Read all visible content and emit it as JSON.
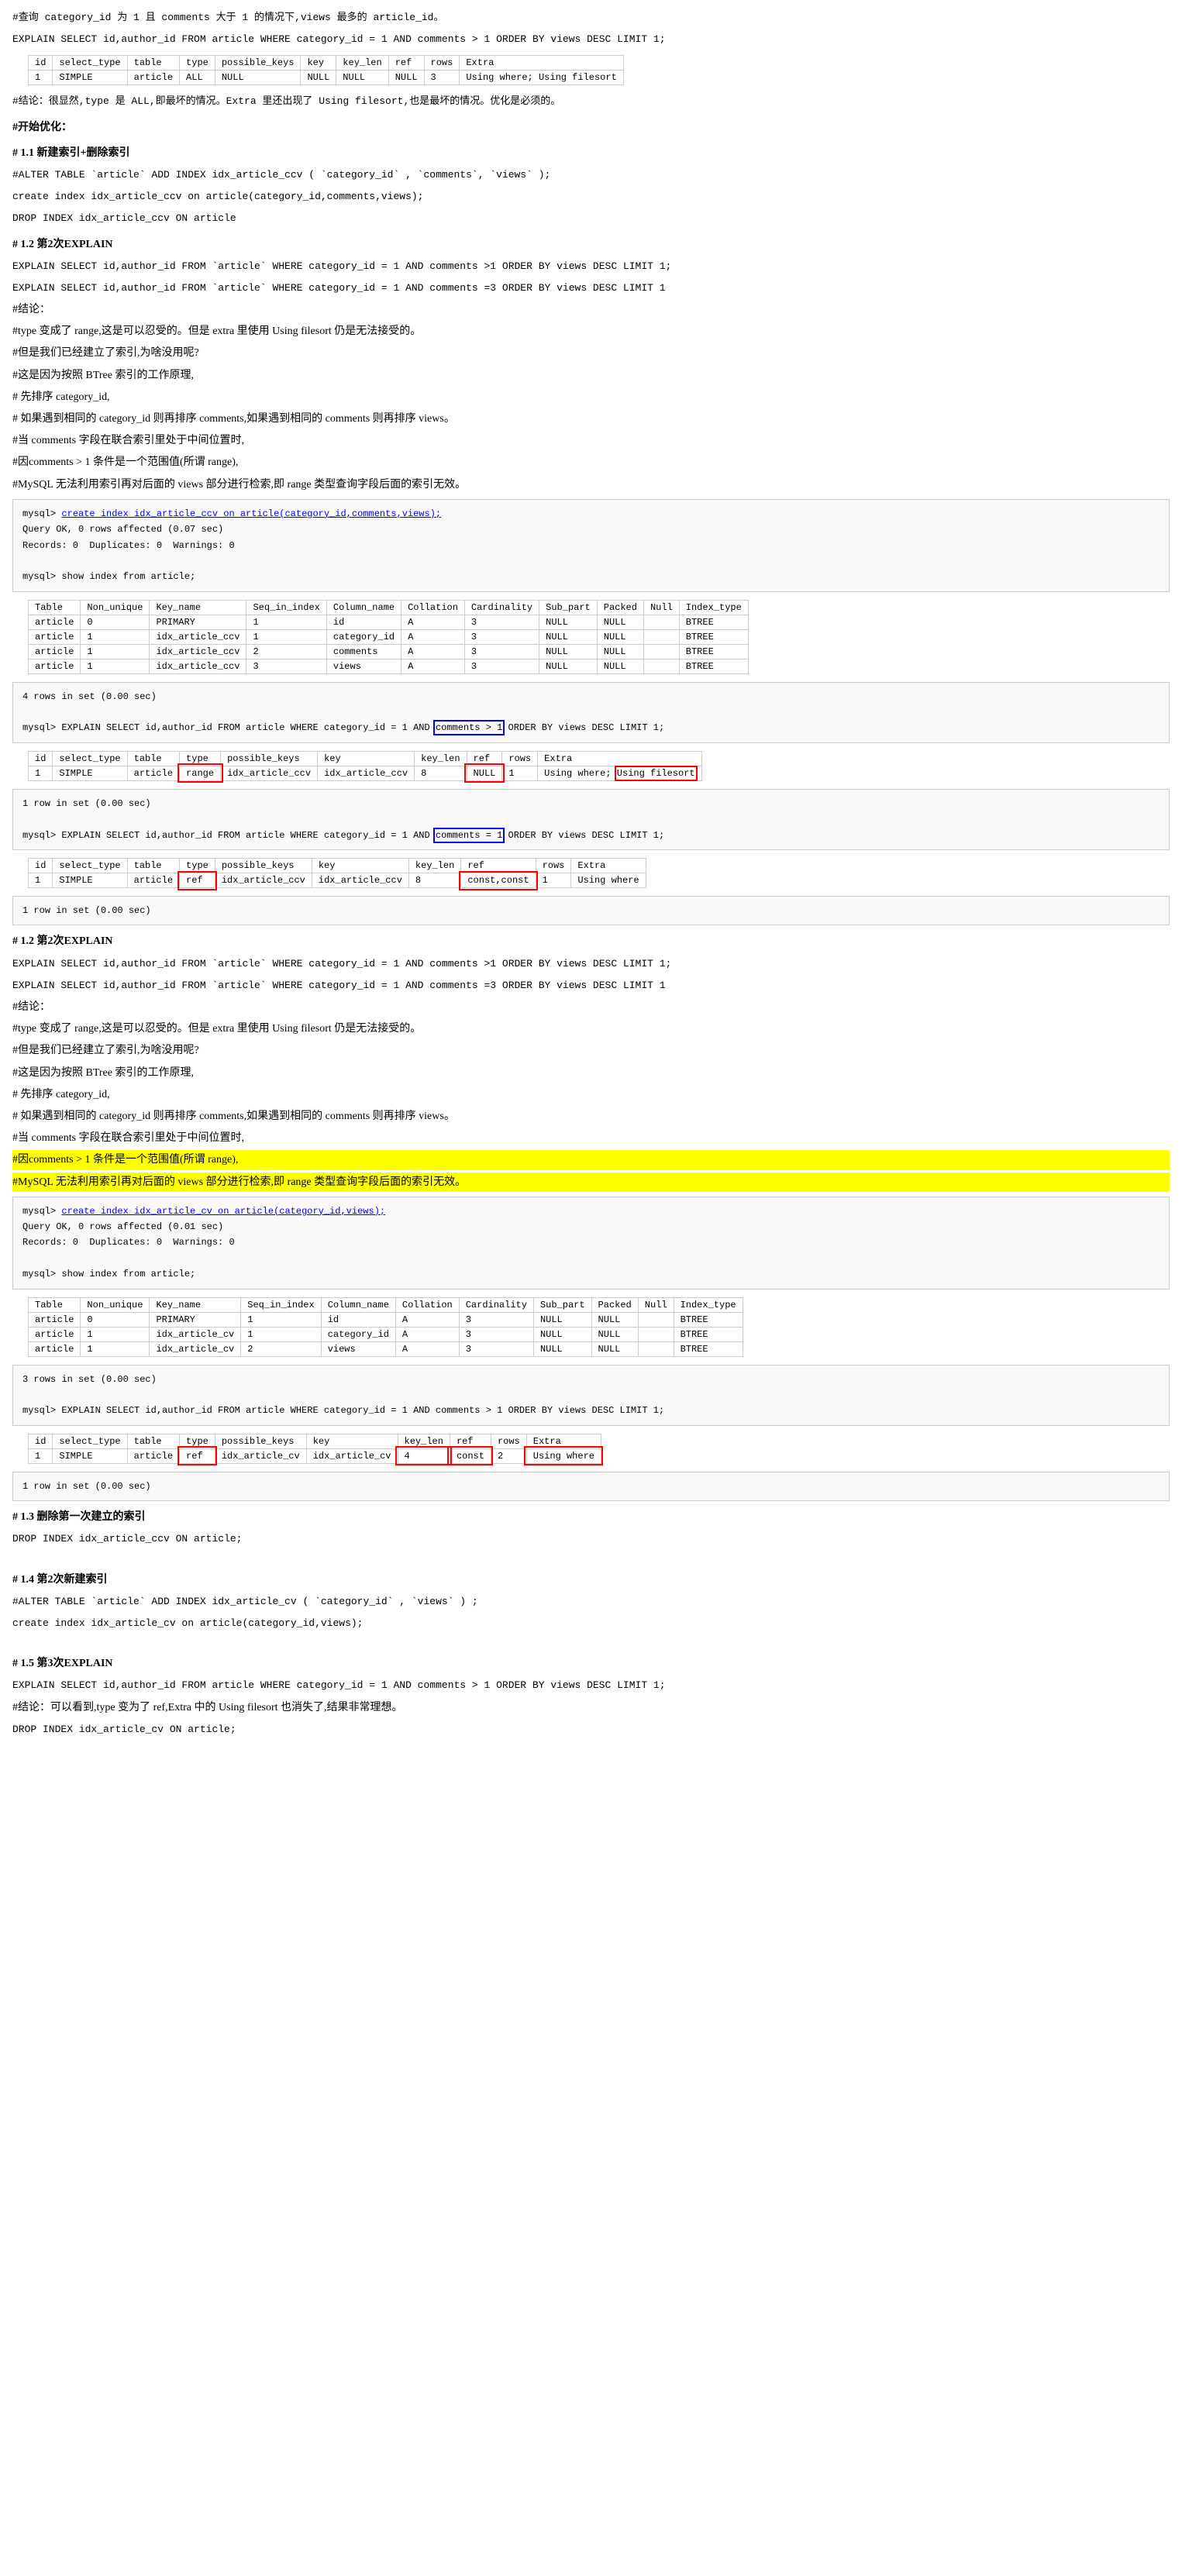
{
  "content": {
    "intro_comment": "#查询 category_id 为 1 且 comments 大于 1 的情况下,views 最多的 article_id。",
    "explain_sql": "EXPLAIN SELECT id,author_id FROM article WHERE category_id = 1 AND comments > 1 ORDER BY views DESC LIMIT 1;",
    "conclusion1_title": "#结论：很显然,type 是 ALL,即最坏的情况。Extra 里还出现了 Using filesort,也是最坏的情况。优化是必须的。",
    "optimize_title": "#开始优化：",
    "sec11_title": "# 1.1 新建索引+删除索引",
    "alter_comment": "#ALTER TABLE `article` ADD INDEX idx_article_ccv ( `category_id` , `comments`, `views` );",
    "create_index": "create index idx_article_ccv on article(category_id,comments,views);",
    "drop_index": "DROP INDEX idx_article_ccv ON article",
    "sec12_title": "# 1.2 第2次EXPLAIN",
    "explain2_1": "EXPLAIN SELECT id,author_id FROM `article` WHERE category_id = 1 AND comments >1 ORDER BY views DESC LIMIT 1;",
    "explain2_2": "EXPLAIN SELECT id,author_id FROM `article` WHERE category_id = 1 AND comments =3 ORDER BY views DESC LIMIT 1",
    "jielun_label": "#结论：",
    "jielun_lines": [
      "#type 变成了 range,这是可以忍受的。但是 extra 里使用 Using filesort 仍是无法接受的。",
      "#但是我们已经建立了索引,为啥没用呢?",
      "#这是因为按照 BTree 索引的工作原理,",
      "# 先排序 category_id,",
      "# 如果遇到相同的 category_id 则再排序 comments,如果遇到相同的 comments 则再排序 views。",
      "#当 comments 字段在联合索引里处于中间位置时,",
      "#因comments > 1 条件是一个范围值(所谓 range),",
      "#MySQL 无法利用索引再对后面的 views 部分进行检索,即 range 类型查询字段后面的索引无效。"
    ],
    "sec12b_title": "# 1.2 第2次EXPLAIN",
    "explain2b_1": "EXPLAIN SELECT id,author_id FROM `article` WHERE category_id = 1 AND comments >1 ORDER BY views DESC LIMIT 1;",
    "explain2b_2": "EXPLAIN SELECT id,author_id FROM `article` WHERE category_id = 1 AND comments =3 ORDER BY views DESC LIMIT 1",
    "jielun2_label": "#结论：",
    "jielun2_lines": [
      "#type 变成了 range,这是可以忍受的。但是 extra 里使用 Using filesort 仍是无法接受的。",
      "#但是我们已经建立了索引,为啥没用呢?",
      "#这是因为按照 BTree 索引的工作原理,",
      "# 先排序 category_id,",
      "# 如果遇到相同的 category_id 则再排序 comments,如果遇到相同的 comments 则再排序 views。",
      "#当 comments 字段在联合索引里处于中间位置时,"
    ],
    "highlight_lines": [
      "#因comments > 1 条件是一个范围值(所谓 range),",
      "#MySQL 无法利用索引再对后面的 views 部分进行检索,即 range 类型查询字段后面的索引无效。"
    ],
    "sec13_title": "# 1.3 删除第一次建立的索引",
    "drop_index_13": "DROP INDEX idx_article_ccv ON article;",
    "sec14_title": "# 1.4 第2次新建索引",
    "alter_14": "#ALTER TABLE `article` ADD INDEX idx_article_cv ( `category_id` , `views` ) ;",
    "create_14": "create index idx_article_cv on article(category_id,views);",
    "sec15_title": "# 1.5 第3次EXPLAIN",
    "explain_15": "EXPLAIN SELECT id,author_id FROM article WHERE category_id = 1 AND comments > 1 ORDER BY views DESC LIMIT 1;",
    "jielun_15": "#结论：可以看到,type 变为了 ref,Extra 中的 Using filesort 也消失了,结果非常理想。",
    "drop_15": "DROP INDEX idx_article_cv ON article;"
  }
}
